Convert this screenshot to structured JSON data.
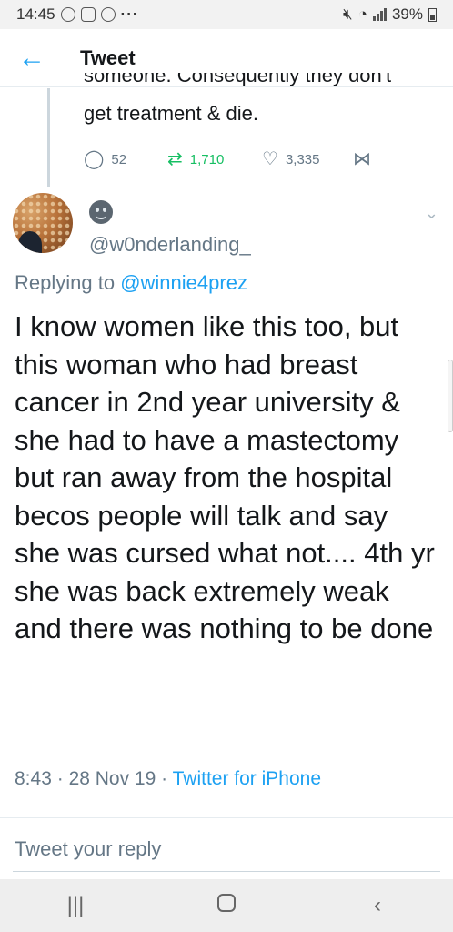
{
  "status_bar": {
    "time": "14:45",
    "more": "···",
    "battery": "39%"
  },
  "header": {
    "back_icon": "arrow-left-icon",
    "title": "Tweet"
  },
  "previous_tweet": {
    "cut_text": "someone. Consequently they don't",
    "visible_text": "get treatment & die.",
    "replies": "52",
    "retweets": "1,710",
    "likes": "3,335"
  },
  "tweet": {
    "handle": "@w0nderlanding_",
    "replying_prefix": "Replying to",
    "replying_to": "@winnie4prez",
    "text": "I know women like this too, but this woman who had breast cancer in 2nd year university & she had to have a mastectomy but ran away from the hospital becos people will talk and say she was cursed what not.... 4th yr she was back extremely weak and there was nothing to be done",
    "time": "8:43",
    "sep1": "·",
    "date": "28 Nov 19",
    "sep2": "·",
    "source": "Twitter for iPhone"
  },
  "reply_box": {
    "placeholder": "Tweet your reply"
  },
  "nav": {
    "recents": "|||",
    "home": "",
    "back": "‹"
  },
  "colors": {
    "accent": "#1da1f2",
    "retweet": "#17bf63",
    "muted": "#657786"
  }
}
